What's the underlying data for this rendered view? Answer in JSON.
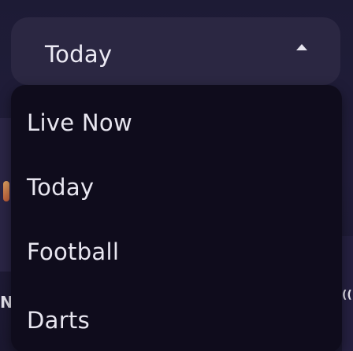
{
  "dropdown": {
    "selected_label": "Today",
    "caret_icon": "chevron-up-icon",
    "options": [
      {
        "label": "Live Now"
      },
      {
        "label": "Today"
      },
      {
        "label": "Football"
      },
      {
        "label": "Darts"
      }
    ]
  },
  "background": {
    "left_letter": "N",
    "right_letter": "(("
  },
  "colors": {
    "header_bg": "#2b2742",
    "panel_bg": "#0f0c1c",
    "text": "#e8e6f0"
  }
}
